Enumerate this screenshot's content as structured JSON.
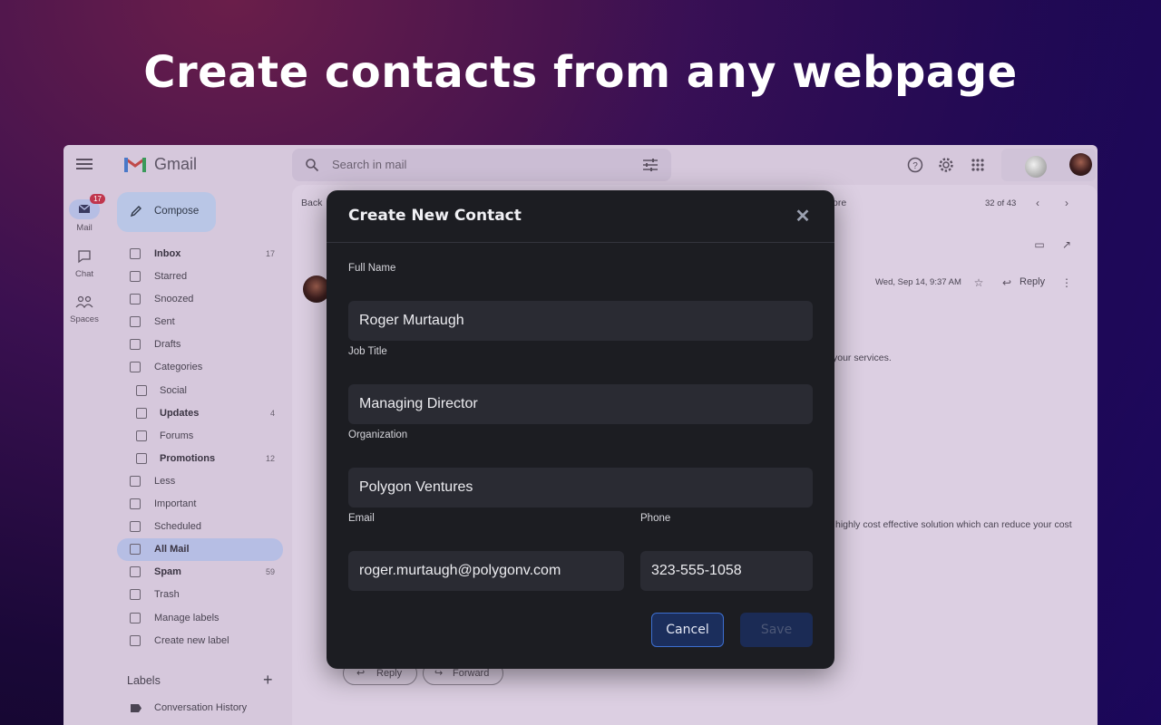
{
  "headline": "Create contacts from any webpage",
  "gmail": {
    "brand": "Gmail",
    "search_placeholder": "Search in mail",
    "rail": [
      {
        "label": "Mail",
        "badge": "17"
      },
      {
        "label": "Chat"
      },
      {
        "label": "Spaces"
      }
    ],
    "compose_label": "Compose",
    "nav": [
      {
        "label": "Inbox",
        "count": "17",
        "bold": true
      },
      {
        "label": "Starred"
      },
      {
        "label": "Snoozed"
      },
      {
        "label": "Sent"
      },
      {
        "label": "Drafts"
      },
      {
        "label": "Categories"
      },
      {
        "label": "Social",
        "sub": true
      },
      {
        "label": "Updates",
        "count": "4",
        "bold": true,
        "sub": true
      },
      {
        "label": "Forums",
        "sub": true
      },
      {
        "label": "Promotions",
        "count": "12",
        "bold": true,
        "sub": true
      },
      {
        "label": "Less"
      },
      {
        "label": "Important"
      },
      {
        "label": "Scheduled"
      },
      {
        "label": "All Mail",
        "bold": true,
        "active": true
      },
      {
        "label": "Spam",
        "count": "59",
        "bold": true
      },
      {
        "label": "Trash"
      },
      {
        "label": "Manage labels"
      },
      {
        "label": "Create new label"
      }
    ],
    "labels_heading": "Labels",
    "labels": [
      "Conversation History"
    ],
    "mail": {
      "back_label": "Back",
      "more_label": "ore",
      "pager": "32 of 43",
      "date": "Wed, Sep 14, 9:37 AM",
      "reply_label": "Reply",
      "snippet1": "your services.",
      "snippet2": "highly cost effective solution which can reduce your cost",
      "reply_button": "Reply",
      "forward_button": "Forward"
    }
  },
  "modal": {
    "title": "Create New Contact",
    "fields": {
      "full_name": {
        "label": "Full Name",
        "value": "Roger Murtaugh"
      },
      "job_title": {
        "label": "Job Title",
        "value": "Managing Director"
      },
      "organization": {
        "label": "Organization",
        "value": "Polygon Ventures"
      },
      "email": {
        "label": "Email",
        "value": "roger.murtaugh@polygonv.com"
      },
      "phone": {
        "label": "Phone",
        "value": "323-555-1058"
      }
    },
    "cancel_label": "Cancel",
    "save_label": "Save"
  }
}
